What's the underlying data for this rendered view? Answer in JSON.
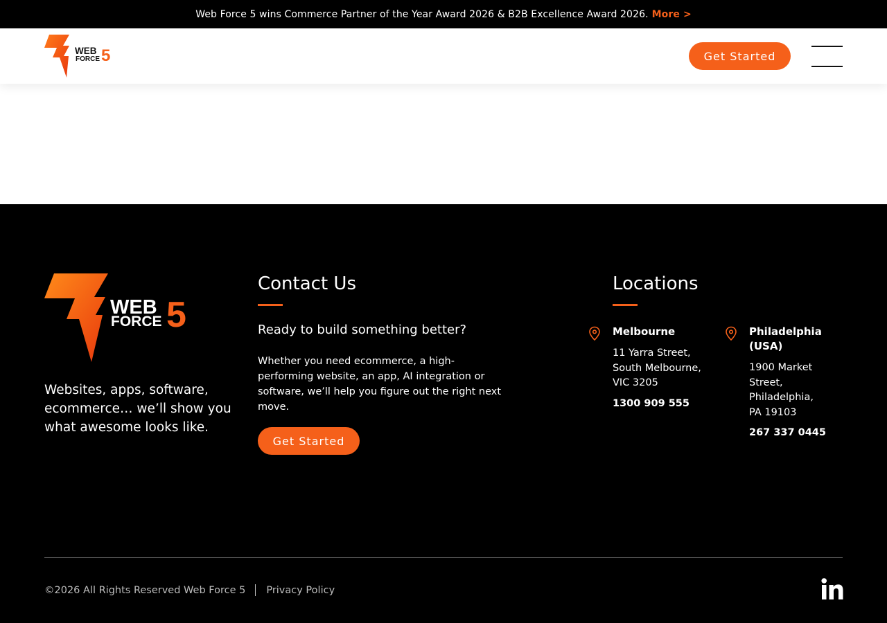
{
  "announcement": {
    "text": "Web Force 5 wins Commerce Partner of the Year Award 2026 & B2B Excellence Award 2026.",
    "more_label": "More >"
  },
  "header": {
    "logo_text_top": "WEB",
    "logo_text_bottom": "FORCE",
    "logo_number": "5",
    "cta_label": "Get Started",
    "menu_icon": "hamburger-menu-icon"
  },
  "footer": {
    "tagline": "Websites, apps, software, ecommerce… we’ll show you what awesome looks like.",
    "contact": {
      "heading": "Contact Us",
      "subheading": "Ready to build something better?",
      "description": "Whether you need ecommerce, a high-performing website, an app, AI integration or software, we’ll help you figure out the right next move.",
      "cta_label": "Get Started"
    },
    "locations": {
      "heading": "Locations",
      "items": [
        {
          "city": "Melbourne",
          "address_1": "11 Yarra Street,",
          "address_2": "South Melbourne,",
          "address_3": "VIC 3205",
          "phone": "1300 909 555"
        },
        {
          "city": "Philadelphia (USA)",
          "address_1": "1900 Market Street,",
          "address_2": "Philadelphia,",
          "address_3": "PA 19103",
          "phone": "267 337 0445"
        }
      ]
    },
    "copyright": "©2026 All Rights Reserved Web Force 5",
    "privacy_label": "Privacy Policy",
    "social_icon": "linkedin-icon"
  },
  "colors": {
    "accent": "#f5601a",
    "background_dark": "#000000",
    "header_bg": "#ffffff"
  }
}
